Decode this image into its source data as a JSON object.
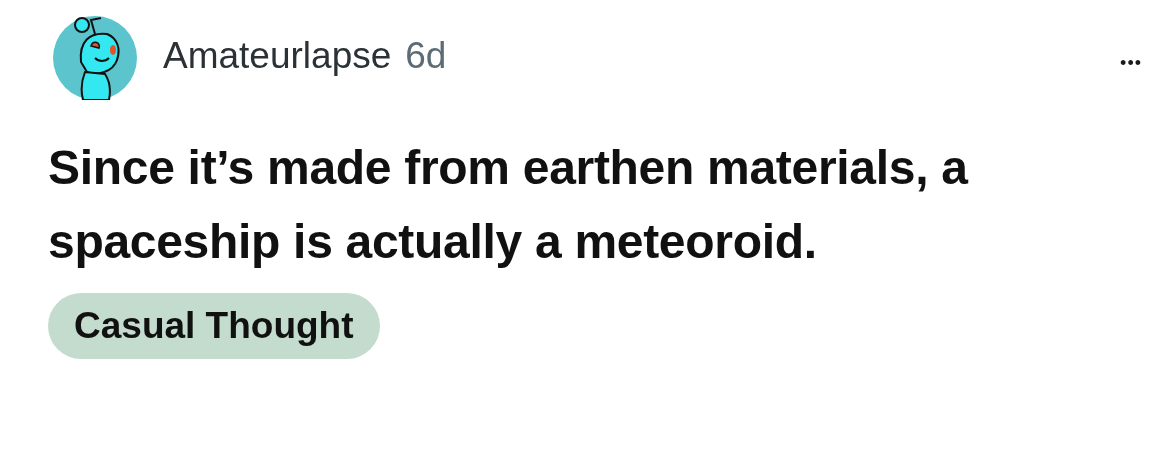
{
  "post": {
    "author": "Amateurlapse",
    "age": "6d",
    "more": "•••",
    "title": "Since it’s made from earthen materials, a spaceship is actually a meteoroid.",
    "flair": {
      "label": "Casual Thought",
      "color": "#c3dccd"
    }
  }
}
